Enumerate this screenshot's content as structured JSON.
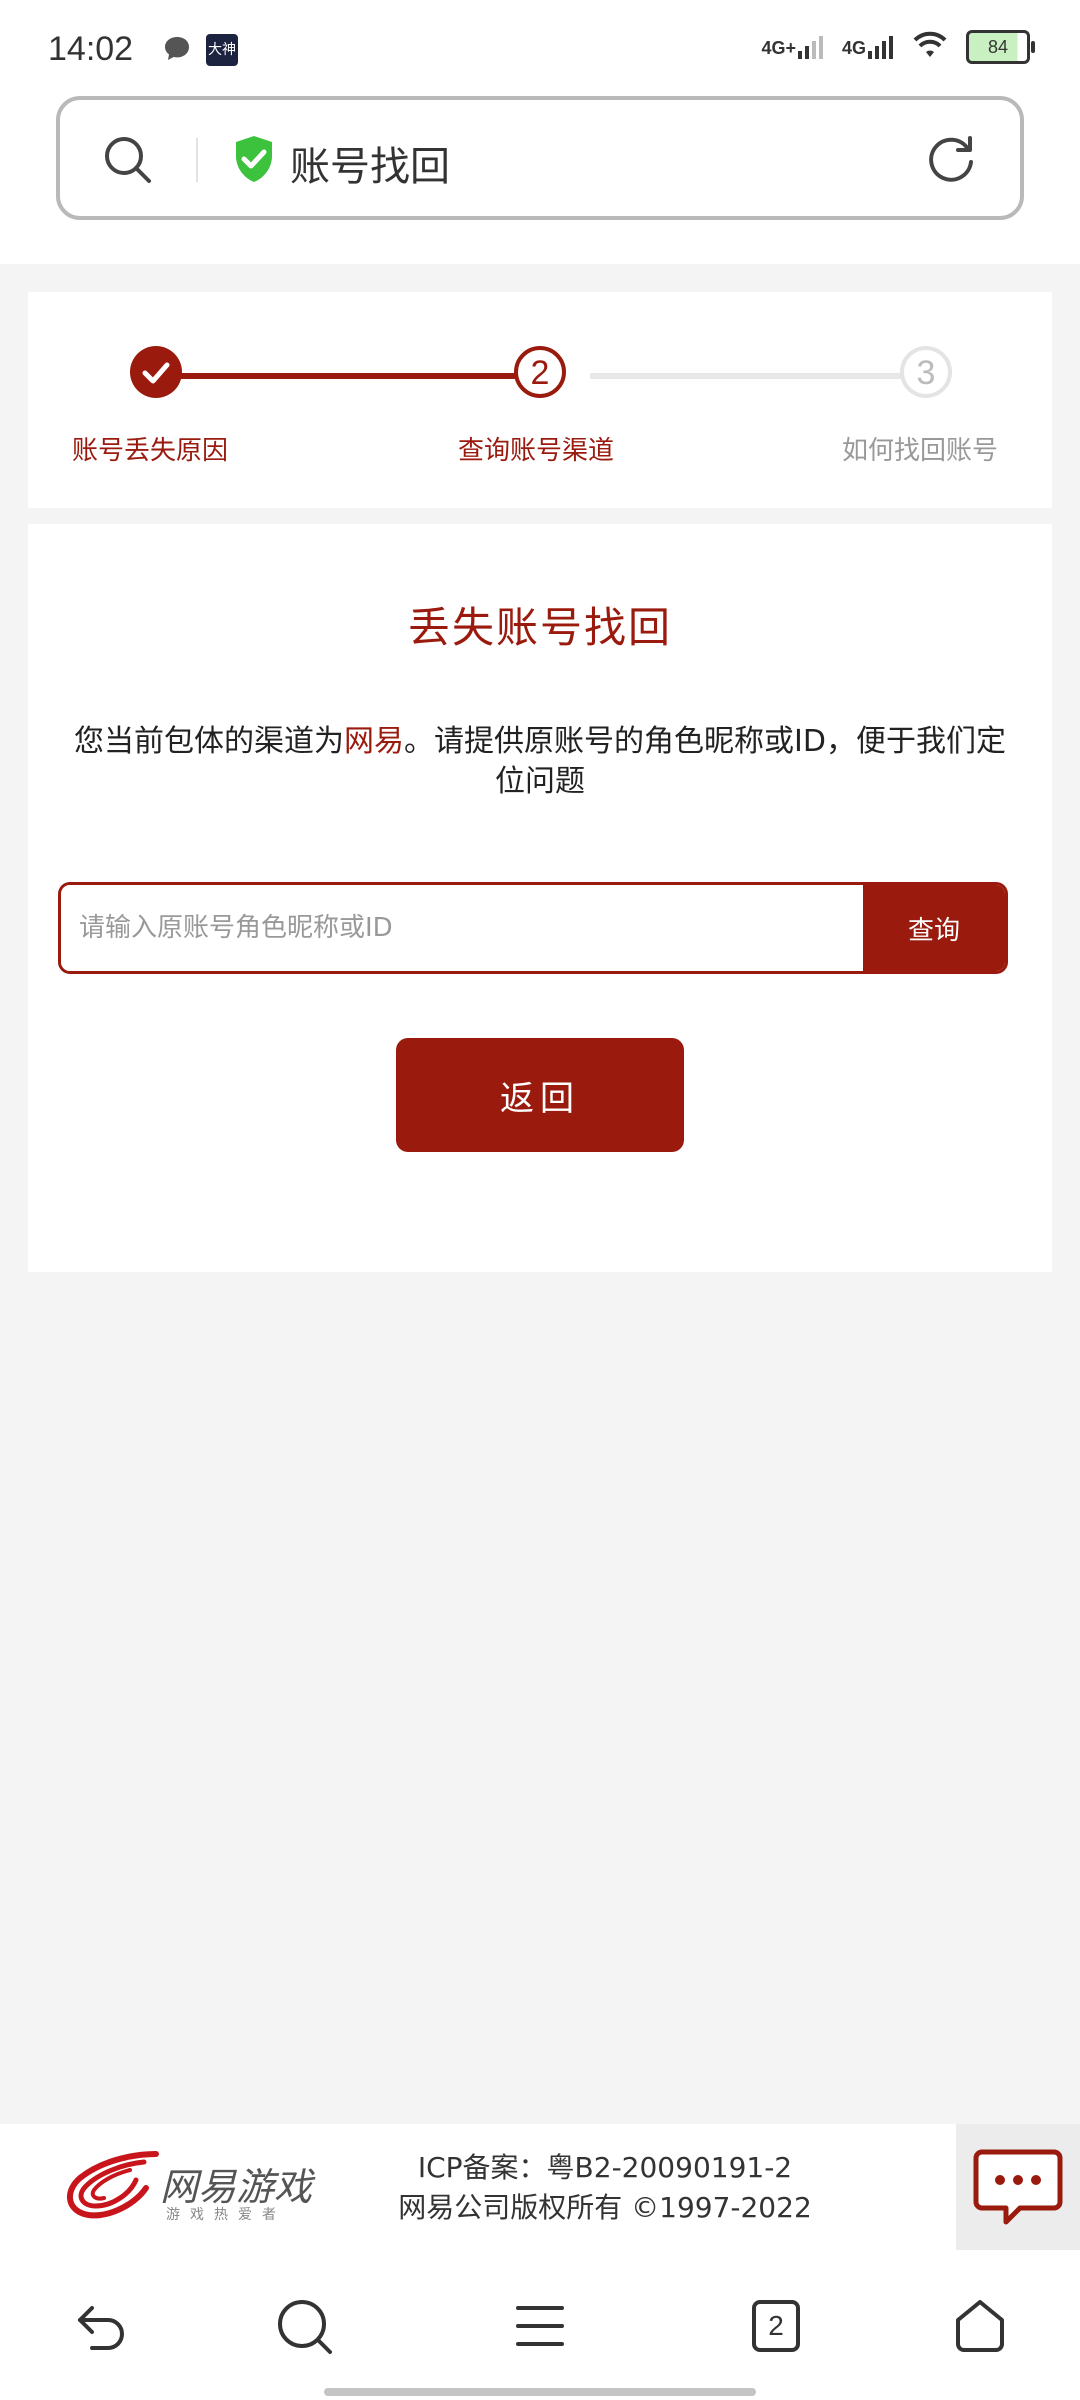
{
  "status_bar": {
    "time": "14:02",
    "app_icon_text": "大神",
    "network1": "4G+",
    "network2": "4G",
    "battery": "84"
  },
  "address_bar": {
    "title": "账号找回"
  },
  "steps": [
    {
      "label": "账号丢失原因",
      "state": "done"
    },
    {
      "number": "2",
      "label": "查询账号渠道",
      "state": "active"
    },
    {
      "number": "3",
      "label": "如何找回账号",
      "state": "todo"
    }
  ],
  "main": {
    "title": "丢失账号找回",
    "desc_before": "您当前包体的渠道为",
    "desc_channel": "网易",
    "desc_after": "。请提供原账号的角色昵称或ID，便于我们定位问题",
    "input_placeholder": "请输入原账号角色昵称或ID",
    "query_label": "查询",
    "back_label": "返回"
  },
  "footer": {
    "logo_text": "网易游戏",
    "logo_sub": "游戏热爱者",
    "icp": "ICP备案：粤B2-20090191-2",
    "copyright": "网易公司版权所有 ©1997-2022"
  },
  "bottom_nav": {
    "tabs_count": "2"
  },
  "colors": {
    "brand": "#9a1a0e",
    "shield": "#3cc23c"
  }
}
